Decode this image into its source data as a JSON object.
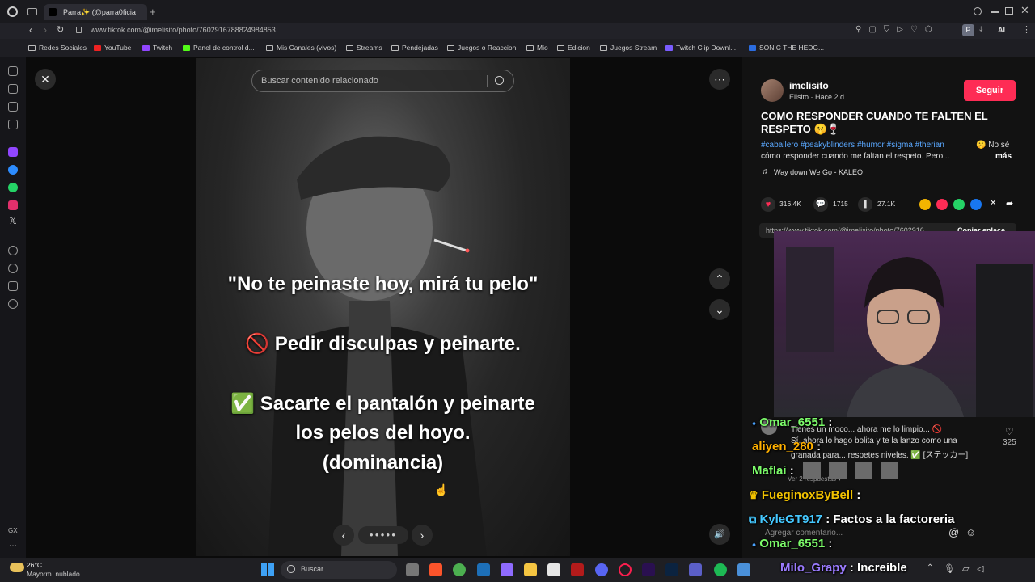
{
  "browser": {
    "tab_title": "Parra✨ (@parra0ficia",
    "url": "www.tiktok.com/@imelisito/photo/7602916788824984853",
    "bookmarks": [
      {
        "label": "Redes Sociales"
      },
      {
        "label": "YouTube"
      },
      {
        "label": "Twitch"
      },
      {
        "label": "Panel de control d..."
      },
      {
        "label": "Mis Canales (vivos)"
      },
      {
        "label": "Streams"
      },
      {
        "label": "Pendejadas"
      },
      {
        "label": "Juegos o Reaccion"
      },
      {
        "label": "Mio"
      },
      {
        "label": "Edicion"
      },
      {
        "label": "Juegos Stream"
      },
      {
        "label": "Twitch Clip Downl..."
      },
      {
        "label": "SONIC THE HEDG..."
      }
    ],
    "sidebar_bottom_label": "GX",
    "profile_initial": "P",
    "ai_label": "AI"
  },
  "viewer": {
    "search_placeholder": "Buscar contenido relacionado",
    "caption_lines": [
      "\"No te peinaste hoy, mirá tu pelo\"",
      "🚫 Pedir disculpas y peinarte.",
      "✅ Sacarte el pantalón y peinarte",
      "los pelos del hoyo.",
      "(dominancia)"
    ]
  },
  "post": {
    "username": "imelisito",
    "meta": "Elisito · Hace 2 d",
    "follow_label": "Seguir",
    "title": "COMO RESPONDER CUANDO TE FALTEN EL RESPETO 🤫🍷",
    "hashtags": "#caballero #peakyblinders #humor #sigma #therian",
    "description_tail": "🤫 No sé",
    "description_line2": "cómo responder cuando me faltan el respeto. Pero...",
    "more_label": "más",
    "music": "Way down We Go - KALEO",
    "likes": "316.4K",
    "comments": "1715",
    "saves": "27.1K",
    "link_text": "https://www.tiktok.com/@imelisito/photo/7602916",
    "copy_label": "Copiar enlace",
    "comment_placeholder": "Agregar comentario...",
    "comment_like_count": "325"
  },
  "chat": [
    {
      "user": "Omar_6551",
      "color": "#7CFC6A",
      "message": ""
    },
    {
      "user": "aliyen_280",
      "color": "#ffb000",
      "message": ""
    },
    {
      "user": "Maflai",
      "color": "#7CFC6A",
      "message": ""
    },
    {
      "user": "FueginoxByBell",
      "color": "#f2c200",
      "message": ""
    },
    {
      "user": "KyleGT917",
      "color": "#45c8ff",
      "message": "Factos a la factoreria"
    },
    {
      "user": "Omar_6551",
      "color": "#7CFC6A",
      "message": ""
    },
    {
      "user": "Milo_Grapy",
      "color": "#9b7bff",
      "message": "Increíble"
    }
  ],
  "comment_overlay": {
    "line1": "Tienes un moco... ahora me lo limpio... 🚫",
    "line2": "Sí, ahora lo hago bolita y te la lanzo como una",
    "line3": "granada para... respetes niveles. ✅ [ステッカー]",
    "replies": "Ver 2 respuestas ▾"
  },
  "taskbar": {
    "weather_temp": "26°C",
    "weather_desc": "Mayorm. nublado",
    "search_label": "Buscar"
  }
}
